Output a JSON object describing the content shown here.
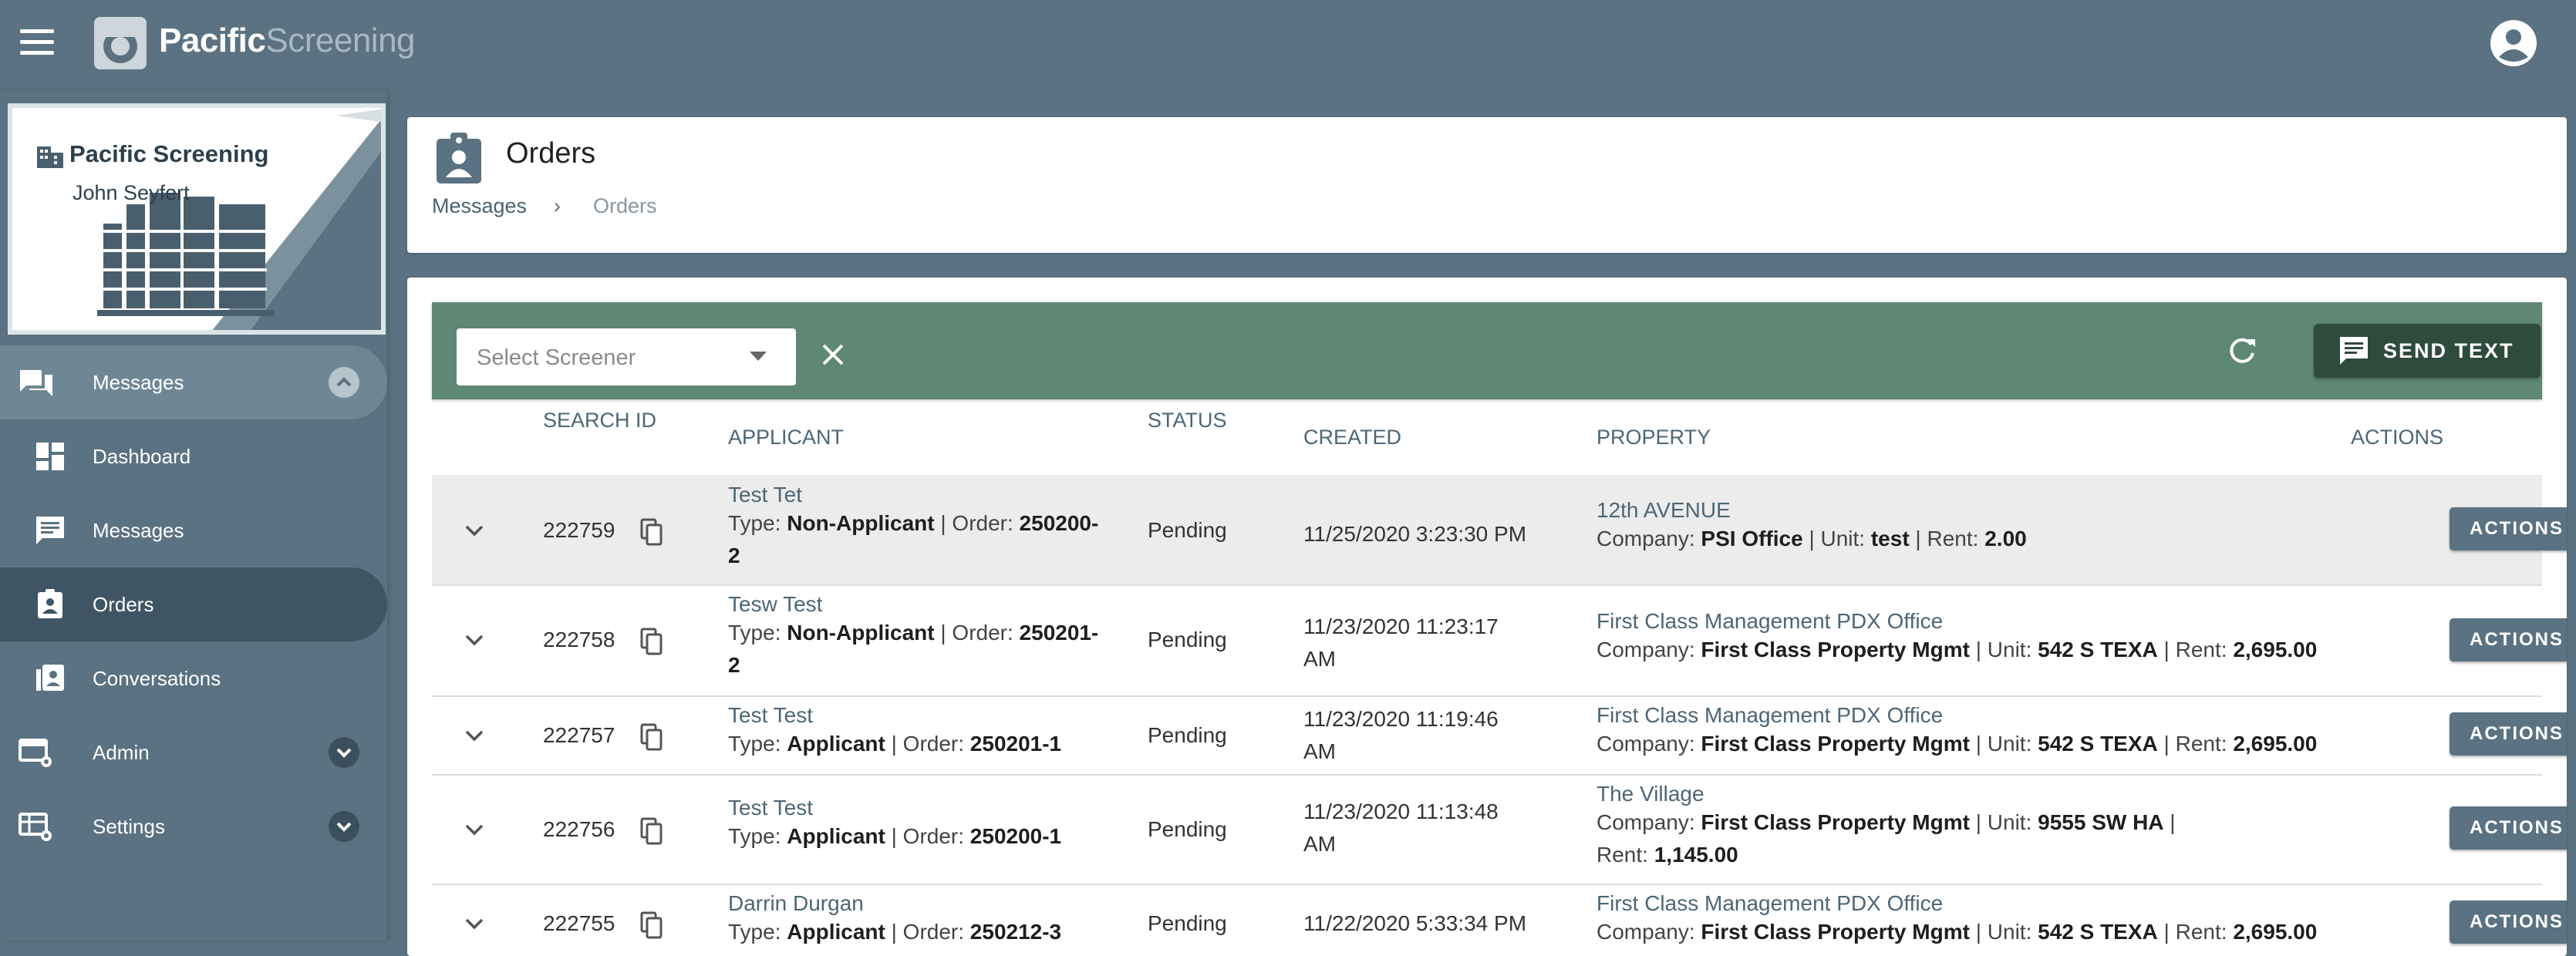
{
  "app": {
    "logo_primary": "Pacific",
    "logo_secondary": "Screening"
  },
  "profile": {
    "org_name": "Pacific Screening",
    "user_name": "John Seyfert"
  },
  "sidebar": {
    "items": [
      {
        "label": "Messages"
      },
      {
        "label": "Dashboard"
      },
      {
        "label": "Messages"
      },
      {
        "label": "Orders"
      },
      {
        "label": "Conversations"
      },
      {
        "label": "Admin"
      },
      {
        "label": "Settings"
      }
    ]
  },
  "header": {
    "title": "Orders",
    "breadcrumb": [
      "Messages",
      "Orders"
    ],
    "breadcrumb_separator": "›"
  },
  "toolbar": {
    "screener_placeholder": "Select Screener",
    "send_text_label": "SEND TEXT"
  },
  "table": {
    "columns": {
      "search_id": "SEARCH ID",
      "applicant": "APPLICANT",
      "status": "STATUS",
      "created": "CREATED",
      "property": "PROPERTY",
      "actions": "ACTIONS"
    },
    "labels": {
      "type": "Type:",
      "order": "| Order:",
      "company": "Company:",
      "unit": "| Unit:",
      "rent": "Rent:"
    },
    "rows": [
      {
        "id": "222759",
        "applicant": "Test Tet",
        "type": "Non-Applicant",
        "order": "250200-",
        "order_wrap": "2",
        "status": "Pending",
        "created": "11/25/2020 3:23:30 PM",
        "created_wrap": "",
        "property": "12th AVENUE",
        "company": "PSI Office",
        "unit": "test",
        "rent": "2.00",
        "action": "ACTIONS"
      },
      {
        "id": "222758",
        "applicant": "Tesw Test",
        "type": "Non-Applicant",
        "order": "250201-",
        "order_wrap": "2",
        "status": "Pending",
        "created": "11/23/2020 11:23:17",
        "created_wrap": "AM",
        "property": "First Class Management PDX Office",
        "company": "First Class Property Mgmt",
        "unit": "542 S TEXA",
        "rent": "2,695.00",
        "action": "ACTIONS"
      },
      {
        "id": "222757",
        "applicant": "Test Test",
        "type": "Applicant",
        "order": "250201-1",
        "order_wrap": "",
        "status": "Pending",
        "created": "11/23/2020 11:19:46",
        "created_wrap": "AM",
        "property": "First Class Management PDX Office",
        "company": "First Class Property Mgmt",
        "unit": "542 S TEXA",
        "rent": "2,695.00",
        "action": "ACTIONS"
      },
      {
        "id": "222756",
        "applicant": "Test Test",
        "type": "Applicant",
        "order": "250200-1",
        "order_wrap": "",
        "status": "Pending",
        "created": "11/23/2020 11:13:48",
        "created_wrap": "AM",
        "property": "The Village",
        "company": "First Class Property Mgmt",
        "unit": "9555 SW HA",
        "rent": "1,145.00",
        "action": "ACTIONS"
      },
      {
        "id": "222755",
        "applicant": "Darrin Durgan",
        "type": "Applicant",
        "order": "250212-3",
        "order_wrap": "",
        "status": "Pending",
        "created": "11/22/2020 5:33:34 PM",
        "created_wrap": "",
        "property": "First Class Management PDX Office",
        "company": "First Class Property Mgmt",
        "unit": "542 S TEXA",
        "rent": "2,695.00",
        "action": "ACTIONS"
      }
    ]
  },
  "colors": {
    "topbar": "#5a7281",
    "toolbar": "#5e8775",
    "send_button": "#2f4b3e",
    "action_button": "#5a7281"
  }
}
